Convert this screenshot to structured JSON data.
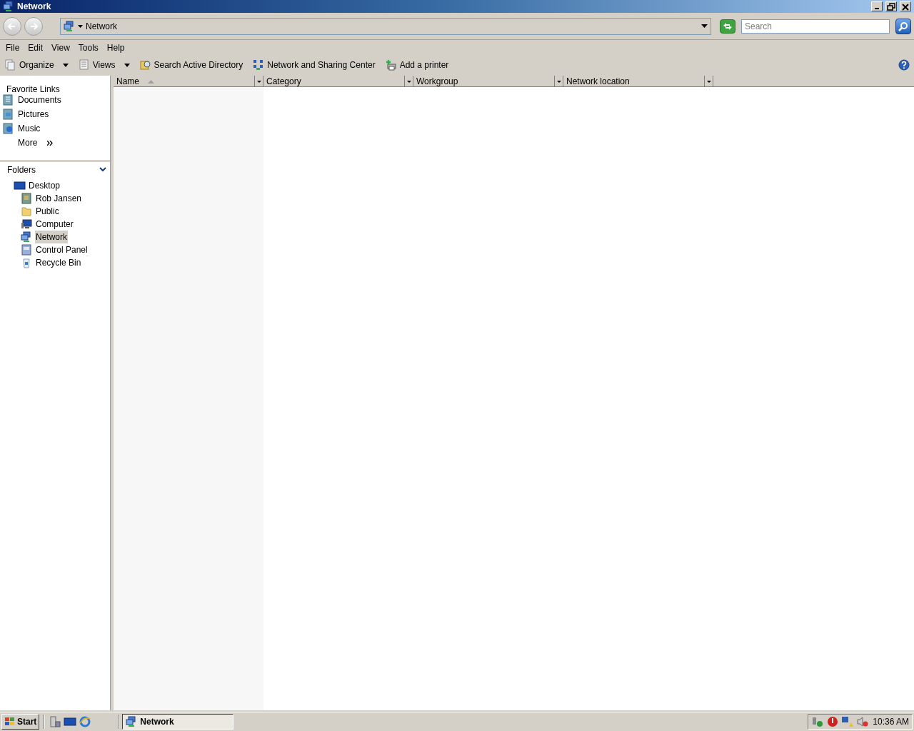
{
  "window": {
    "title": "Network"
  },
  "address_bar": {
    "path": "Network",
    "search": {
      "placeholder": "Search"
    }
  },
  "menu_bar": [
    "File",
    "Edit",
    "View",
    "Tools",
    "Help"
  ],
  "toolbar": [
    {
      "label": "Organize",
      "kind": "organize"
    },
    {
      "label": "Views",
      "kind": "views"
    },
    {
      "label": "Search Active Directory",
      "kind": "directory"
    },
    {
      "label": "Network and Sharing Center",
      "kind": "sharing"
    },
    {
      "label": "Add a printer",
      "kind": "printer"
    }
  ],
  "favorite_links": {
    "title": "Favorite Links",
    "items": [
      {
        "label": "Documents",
        "kind": "documents"
      },
      {
        "label": "Pictures",
        "kind": "pictures"
      },
      {
        "label": "Music",
        "kind": "music"
      }
    ],
    "more": "More"
  },
  "folders": {
    "title": "Folders",
    "expanded": true,
    "tree": [
      {
        "label": "Desktop",
        "kind": "desktop",
        "selected": false,
        "children": [
          {
            "label": "Rob Jansen",
            "kind": "user",
            "selected": false
          },
          {
            "label": "Public",
            "kind": "folder",
            "selected": false
          },
          {
            "label": "Computer",
            "kind": "computer",
            "selected": false
          },
          {
            "label": "Network",
            "kind": "network",
            "selected": true
          },
          {
            "label": "Control Panel",
            "kind": "control",
            "selected": false
          },
          {
            "label": "Recycle Bin",
            "kind": "recycle",
            "selected": false
          }
        ]
      }
    ]
  },
  "table": {
    "columns": [
      {
        "label": "Name",
        "sorted": true
      },
      {
        "label": "Category",
        "sorted": false
      },
      {
        "label": "Workgroup",
        "sorted": false
      },
      {
        "label": "Network location",
        "sorted": false
      }
    ]
  },
  "taskbar": {
    "start": "Start",
    "tasks": [
      {
        "label": "Network",
        "active": true
      }
    ],
    "clock": "10:36 AM"
  }
}
